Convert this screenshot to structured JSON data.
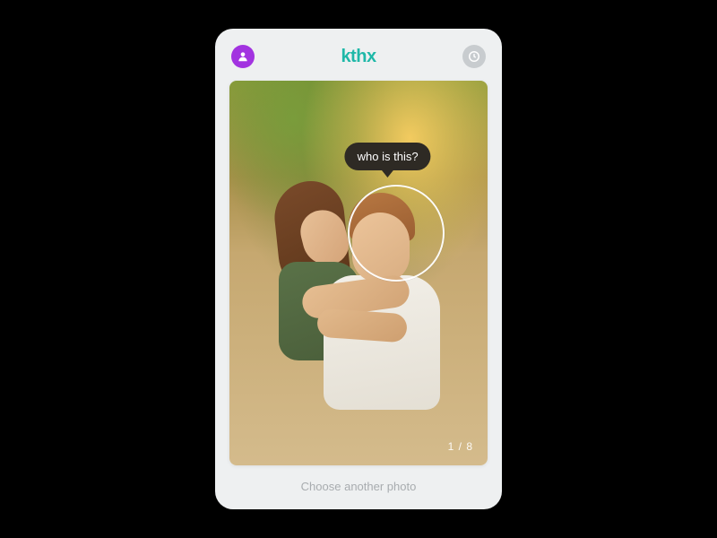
{
  "header": {
    "app_title": "kthx"
  },
  "tooltip": {
    "label": "who is this?"
  },
  "counter": {
    "text": "1 / 8"
  },
  "footer": {
    "choose_another": "Choose another photo"
  }
}
